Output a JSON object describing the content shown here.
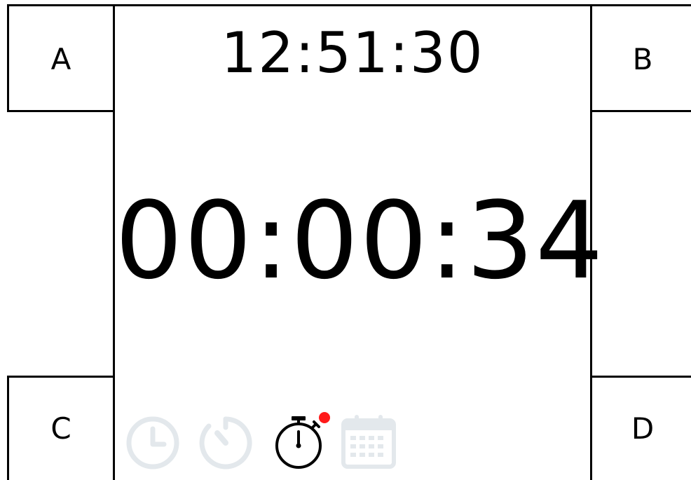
{
  "corners": {
    "top_left": "A",
    "top_right": "B",
    "bottom_left": "C",
    "bottom_right": "D"
  },
  "clock": {
    "time": "12:51:30"
  },
  "timer": {
    "value": "00:00:34"
  },
  "mode_bar": {
    "items": [
      {
        "icon": "clock-icon",
        "state": "inactive"
      },
      {
        "icon": "timer-icon",
        "state": "inactive"
      },
      {
        "icon": "stopwatch-icon",
        "state": "active",
        "indicator": "running"
      },
      {
        "icon": "calendar-icon",
        "state": "inactive"
      }
    ],
    "colors": {
      "inactive": "#e3e8ec",
      "active": "#000000",
      "indicator": "#ff1a1a"
    }
  }
}
